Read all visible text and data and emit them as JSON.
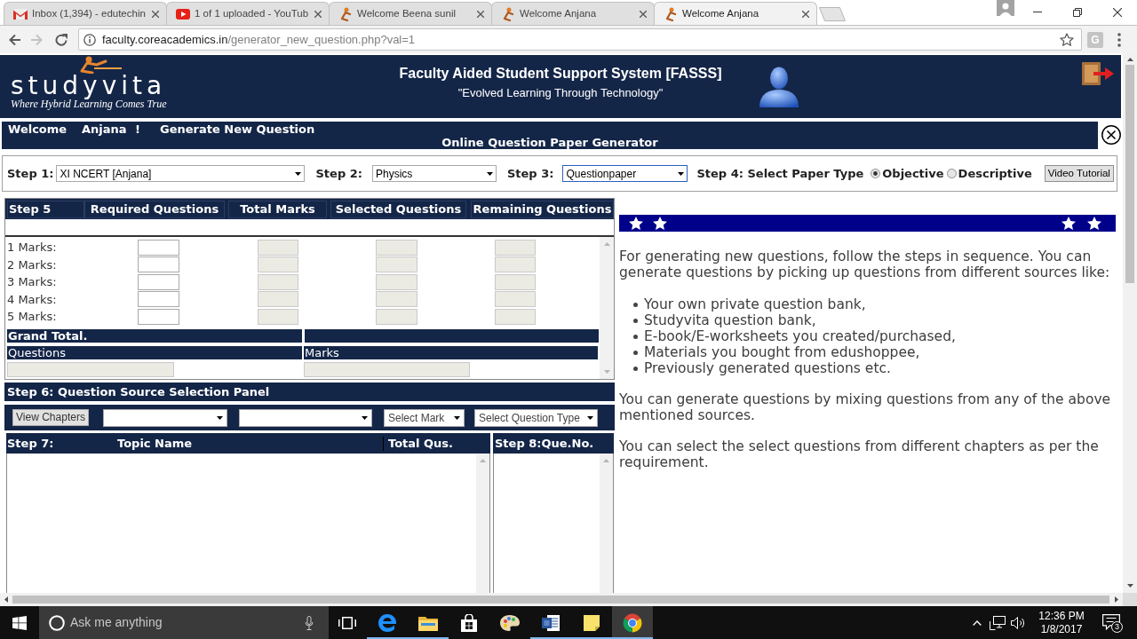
{
  "browser": {
    "tabs": [
      {
        "title": "Inbox (1,394) - edutechin",
        "kind": "gmail",
        "selected": false
      },
      {
        "title": "1 of 1 uploaded - YouTub",
        "kind": "youtube",
        "selected": false
      },
      {
        "title": "Welcome Beena sunil",
        "kind": "site",
        "selected": false
      },
      {
        "title": "Welcome Anjana",
        "kind": "site",
        "selected": false
      },
      {
        "title": "Welcome Anjana",
        "kind": "site",
        "selected": true
      }
    ],
    "nav_buttons": [
      {
        "kind": "back",
        "disabled": false
      },
      {
        "kind": "forward",
        "disabled": true
      },
      {
        "kind": "reload",
        "disabled": false
      }
    ],
    "url": {
      "host": "faculty.coreacademics.in",
      "path": "/generator_new_question.php?val=1"
    },
    "extension_badge": "G"
  },
  "header": {
    "logo_text": "studyvita",
    "logo_tagline": "Where Hybrid Learning Comes True",
    "title": "Faculty Aided Student Support System [FASSS]",
    "subtitle": "\"Evolved Learning Through Technology\""
  },
  "welcome_bar": {
    "greeting": "Welcome",
    "user_name": "Anjana",
    "exclamation": "!",
    "page_title": "Generate New Question",
    "subtitle": "Online Question Paper Generator"
  },
  "steps_bar": {
    "selects": [
      {
        "label": "Step 1:",
        "value": "XI NCERT [Anjana]",
        "focused": false
      },
      {
        "label": "Step 2:",
        "value": "Physics",
        "focused": false
      },
      {
        "label": "Step 3:",
        "value": "Questionpaper",
        "focused": true
      }
    ],
    "paper_type": {
      "label": "Step 4: Select Paper Type",
      "options": [
        {
          "label": "Objective",
          "selected": true
        },
        {
          "label": "Descriptive",
          "selected": false
        }
      ]
    },
    "button": "Video Tutorial"
  },
  "marks_table": {
    "columns": [
      {
        "title": "Step 5",
        "kind": "label"
      },
      {
        "title": "Required Questions",
        "kind": "input"
      },
      {
        "title": "Total Marks",
        "kind": "readonly"
      },
      {
        "title": "Selected Questions",
        "kind": "readonly"
      },
      {
        "title": "Remaining Questions",
        "kind": "readonly"
      }
    ],
    "rows": [
      {
        "label": "1 Marks:"
      },
      {
        "label": "2 Marks:"
      },
      {
        "label": "3 Marks:"
      },
      {
        "label": "4 Marks:"
      },
      {
        "label": "5 Marks:"
      }
    ],
    "grand_total": {
      "title": "Grand Total.",
      "fields": [
        "Questions",
        "Marks"
      ]
    }
  },
  "source_panel": {
    "title": "Step 6: Question Source Selection Panel",
    "controls": [
      {
        "kind": "button",
        "label": "View Chapters"
      },
      {
        "kind": "select"
      },
      {
        "kind": "select"
      },
      {
        "kind": "select",
        "value": "Select Mark"
      },
      {
        "kind": "select",
        "value": "Select Question Type"
      }
    ]
  },
  "topic_table": {
    "columns": [
      "Step 7:",
      "Topic Name",
      "Total Qus."
    ]
  },
  "question_list": {
    "title": "Step 8:Que.No."
  },
  "info_panel": {
    "blocks": [
      {
        "kind": "paragraph",
        "text": "For generating new questions, follow the steps in sequence. You can generate questions by picking up questions from different sources like:"
      },
      {
        "kind": "list",
        "items": [
          "Your own private question bank,",
          "Studyvita question bank,",
          "E-book/E-worksheets you created/purchased,",
          "Materials you bought from edushoppee,",
          "Previously generated questions etc."
        ]
      },
      {
        "kind": "paragraph",
        "text": "You can generate questions by mixing questions from any of the above mentioned sources."
      },
      {
        "kind": "paragraph",
        "text": "You can select the select questions from different chapters as per the requirement."
      }
    ]
  },
  "taskbar": {
    "search_placeholder": "Ask me anything",
    "apps": [
      {
        "kind": "edge",
        "running": true,
        "selected": false
      },
      {
        "kind": "explorer",
        "running": true,
        "selected": false
      },
      {
        "kind": "store",
        "running": false,
        "selected": false
      },
      {
        "kind": "paint",
        "running": false,
        "selected": false
      },
      {
        "kind": "word",
        "running": true,
        "selected": false
      },
      {
        "kind": "sticky_notes",
        "running": true,
        "selected": false
      },
      {
        "kind": "chrome",
        "running": true,
        "selected": true
      }
    ],
    "clock": {
      "time": "12:36 PM",
      "date": "1/8/2017"
    },
    "notification_count": "3"
  }
}
